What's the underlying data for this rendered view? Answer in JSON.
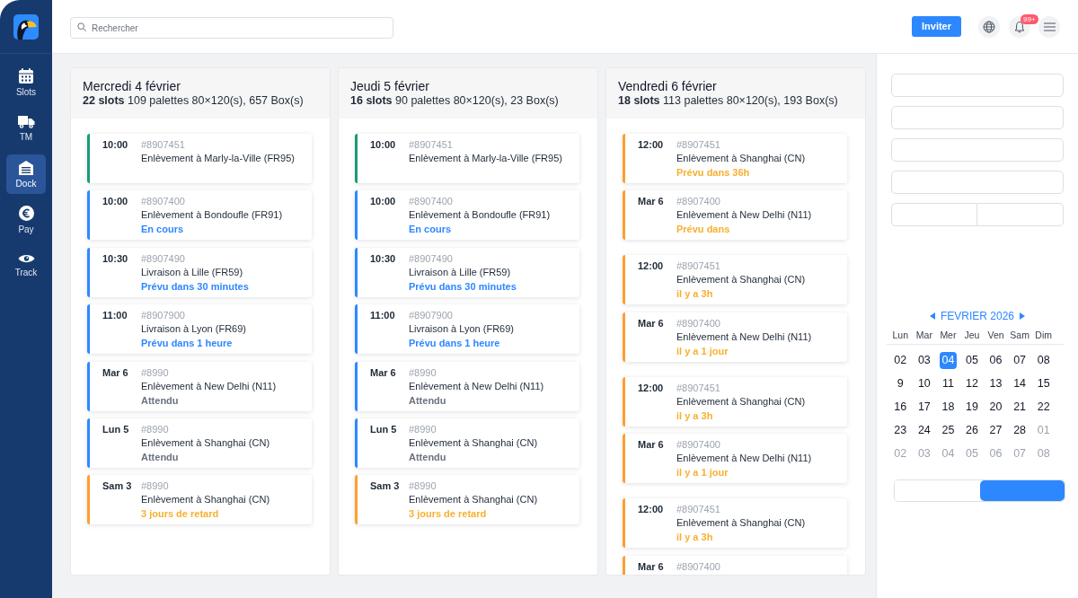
{
  "sidebar": {
    "items": [
      {
        "label": "Slots",
        "selected": false
      },
      {
        "label": "TM",
        "selected": false
      },
      {
        "label": "Dock",
        "selected": true
      },
      {
        "label": "Pay",
        "selected": false
      },
      {
        "label": "Track",
        "selected": false
      }
    ]
  },
  "topbar": {
    "search": {
      "placeholder": "Rechercher"
    },
    "invite_button": "Inviter",
    "notifications_badge": "99+"
  },
  "columns": [
    {
      "title": "Mercredi 4 février",
      "summary": "**22 slots** 109 palettes 80×120(s), 657 Box(s)",
      "groups": [
        [
          {
            "time": "10:00",
            "ref": "#8907451",
            "place": "Enlèvement à Marly-la-Ville (FR95)",
            "color": "#1a9a78"
          },
          {
            "time": "10:00",
            "ref": "#8907400",
            "place": "Enlèvement à Bondoufle (FR91)",
            "color": "#2d88ff",
            "status": {
              "text": "En cours",
              "kind": "info"
            }
          },
          {
            "time": "10:30",
            "ref": "#8907490",
            "place": "Livraison à Lille (FR59)",
            "color": "#2d88ff",
            "status": {
              "text": "Prévu dans 30 minutes",
              "kind": "info"
            }
          },
          {
            "time": "11:00",
            "ref": "#8907900",
            "place": "Livraison à Lyon (FR69)",
            "color": "#2d88ff",
            "status": {
              "text": "Prévu dans 1 heure",
              "kind": "info"
            }
          },
          {
            "time": "Mar 6",
            "ref": "#8990",
            "place": "Enlèvement à New Delhi (N11)",
            "color": "#2d88ff",
            "status": {
              "text": "Attendu",
              "kind": "muted"
            }
          },
          {
            "time": "Lun 5",
            "ref": "#8990",
            "place": "Enlèvement à Shanghai (CN)",
            "color": "#2d88ff",
            "status": {
              "text": "Attendu",
              "kind": "muted"
            }
          },
          {
            "time": "Sam 3",
            "ref": "#8990",
            "place": "Enlèvement à Shanghai (CN)",
            "color": "#ff9f2e",
            "status": {
              "text": "3 jours de retard",
              "kind": "warning"
            }
          }
        ]
      ]
    },
    {
      "title": "Jeudi 5 février",
      "summary": "**16 slots** 90 palettes 80×120(s), 23 Box(s)",
      "groups": [
        [
          {
            "time": "10:00",
            "ref": "#8907451",
            "place": "Enlèvement à Marly-la-Ville (FR95)",
            "color": "#1a9a78"
          },
          {
            "time": "10:00",
            "ref": "#8907400",
            "place": "Enlèvement à Bondoufle (FR91)",
            "color": "#2d88ff",
            "status": {
              "text": "En cours",
              "kind": "info"
            }
          },
          {
            "time": "10:30",
            "ref": "#8907490",
            "place": "Livraison à Lille (FR59)",
            "color": "#2d88ff",
            "status": {
              "text": "Prévu dans 30 minutes",
              "kind": "info"
            }
          },
          {
            "time": "11:00",
            "ref": "#8907900",
            "place": "Livraison à Lyon (FR69)",
            "color": "#2d88ff",
            "status": {
              "text": "Prévu dans 1 heure",
              "kind": "info"
            }
          },
          {
            "time": "Mar 6",
            "ref": "#8990",
            "place": "Enlèvement à New Delhi (N11)",
            "color": "#2d88ff",
            "status": {
              "text": "Attendu",
              "kind": "muted"
            }
          },
          {
            "time": "Lun 5",
            "ref": "#8990",
            "place": "Enlèvement à Shanghai (CN)",
            "color": "#2d88ff",
            "status": {
              "text": "Attendu",
              "kind": "muted"
            }
          },
          {
            "time": "Sam 3",
            "ref": "#8990",
            "place": "Enlèvement à Shanghai (CN)",
            "color": "#ff9f2e",
            "status": {
              "text": "3 jours de retard",
              "kind": "warning"
            }
          }
        ]
      ]
    },
    {
      "title": "Vendredi 6 février",
      "summary": "**18 slots** 113 palettes 80×120(s), 193 Box(s)",
      "groups": [
        [
          {
            "time": "12:00",
            "ref": "#8907451",
            "place": "Enlèvement à Shanghai (CN)",
            "color": "#ff9f2e",
            "status": {
              "text": "Prévu dans 36h",
              "kind": "warning"
            }
          },
          {
            "time": "Mar 6",
            "ref": "#8907400",
            "place": "Enlèvement à New Delhi (N11)",
            "color": "#ff9f2e",
            "status": {
              "text": "Prévu dans",
              "kind": "warning"
            }
          }
        ],
        [
          {
            "time": "12:00",
            "ref": "#8907451",
            "place": "Enlèvement à Shanghai (CN)",
            "color": "#ff9f2e",
            "status": {
              "text": "il y a 3h",
              "kind": "warning"
            }
          },
          {
            "time": "Mar 6",
            "ref": "#8907400",
            "place": "Enlèvement à New Delhi (N11)",
            "color": "#ff9f2e",
            "status": {
              "text": "il y a 1 jour",
              "kind": "warning"
            }
          }
        ],
        [
          {
            "time": "12:00",
            "ref": "#8907451",
            "place": "Enlèvement à Shanghai (CN)",
            "color": "#ff9f2e",
            "status": {
              "text": "il y a 3h",
              "kind": "warning"
            }
          },
          {
            "time": "Mar 6",
            "ref": "#8907400",
            "place": "Enlèvement à New Delhi (N11)",
            "color": "#ff9f2e",
            "status": {
              "text": "il y a 1 jour",
              "kind": "warning"
            }
          }
        ],
        [
          {
            "time": "12:00",
            "ref": "#8907451",
            "place": "Enlèvement à Shanghai (CN)",
            "color": "#ff9f2e",
            "status": {
              "text": "il y a 3h",
              "kind": "warning"
            }
          },
          {
            "time": "Mar 6",
            "ref": "#8907400",
            "color": "#ff9f2e"
          }
        ]
      ]
    }
  ],
  "filters": [
    {
      "kind": "single"
    },
    {
      "kind": "single"
    },
    {
      "kind": "single"
    },
    {
      "kind": "single"
    },
    {
      "kind": "split"
    }
  ],
  "calendar": {
    "month": "FEVRIER 2026",
    "weekdays": [
      "Lun",
      "Mar",
      "Mer",
      "Jeu",
      "Ven",
      "Sam",
      "Dim"
    ],
    "weeks": [
      [
        {
          "day": "02",
          "selected": false,
          "other_month": false
        },
        {
          "day": "03",
          "selected": false,
          "other_month": false
        },
        {
          "day": "04",
          "selected": true,
          "other_month": false
        },
        {
          "day": "05",
          "selected": false,
          "other_month": false
        },
        {
          "day": "06",
          "selected": false,
          "other_month": false
        },
        {
          "day": "07",
          "selected": false,
          "other_month": false
        },
        {
          "day": "08",
          "selected": false,
          "other_month": false
        }
      ],
      [
        {
          "day": "9",
          "selected": false,
          "other_month": false
        },
        {
          "day": "10",
          "selected": false,
          "other_month": false
        },
        {
          "day": "11",
          "selected": false,
          "other_month": false
        },
        {
          "day": "12",
          "selected": false,
          "other_month": false
        },
        {
          "day": "13",
          "selected": false,
          "other_month": false
        },
        {
          "day": "14",
          "selected": false,
          "other_month": false
        },
        {
          "day": "15",
          "selected": false,
          "other_month": false
        }
      ],
      [
        {
          "day": "16",
          "selected": false,
          "other_month": false
        },
        {
          "day": "17",
          "selected": false,
          "other_month": false
        },
        {
          "day": "18",
          "selected": false,
          "other_month": false
        },
        {
          "day": "19",
          "selected": false,
          "other_month": false
        },
        {
          "day": "20",
          "selected": false,
          "other_month": false
        },
        {
          "day": "21",
          "selected": false,
          "other_month": false
        },
        {
          "day": "22",
          "selected": false,
          "other_month": false
        }
      ],
      [
        {
          "day": "23",
          "selected": false,
          "other_month": false
        },
        {
          "day": "24",
          "selected": false,
          "other_month": false
        },
        {
          "day": "25",
          "selected": false,
          "other_month": false
        },
        {
          "day": "26",
          "selected": false,
          "other_month": false
        },
        {
          "day": "27",
          "selected": false,
          "other_month": false
        },
        {
          "day": "28",
          "selected": false,
          "other_month": false
        },
        {
          "day": "01",
          "selected": false,
          "other_month": true
        }
      ],
      [
        {
          "day": "02",
          "selected": false,
          "other_month": true
        },
        {
          "day": "03",
          "selected": false,
          "other_month": true
        },
        {
          "day": "04",
          "selected": false,
          "other_month": true
        },
        {
          "day": "05",
          "selected": false,
          "other_month": true
        },
        {
          "day": "06",
          "selected": false,
          "other_month": true
        },
        {
          "day": "07",
          "selected": false,
          "other_month": true
        },
        {
          "day": "08",
          "selected": false,
          "other_month": true
        }
      ]
    ]
  },
  "toggle": {
    "options": [
      {
        "selected": false
      },
      {
        "selected": true
      }
    ]
  }
}
